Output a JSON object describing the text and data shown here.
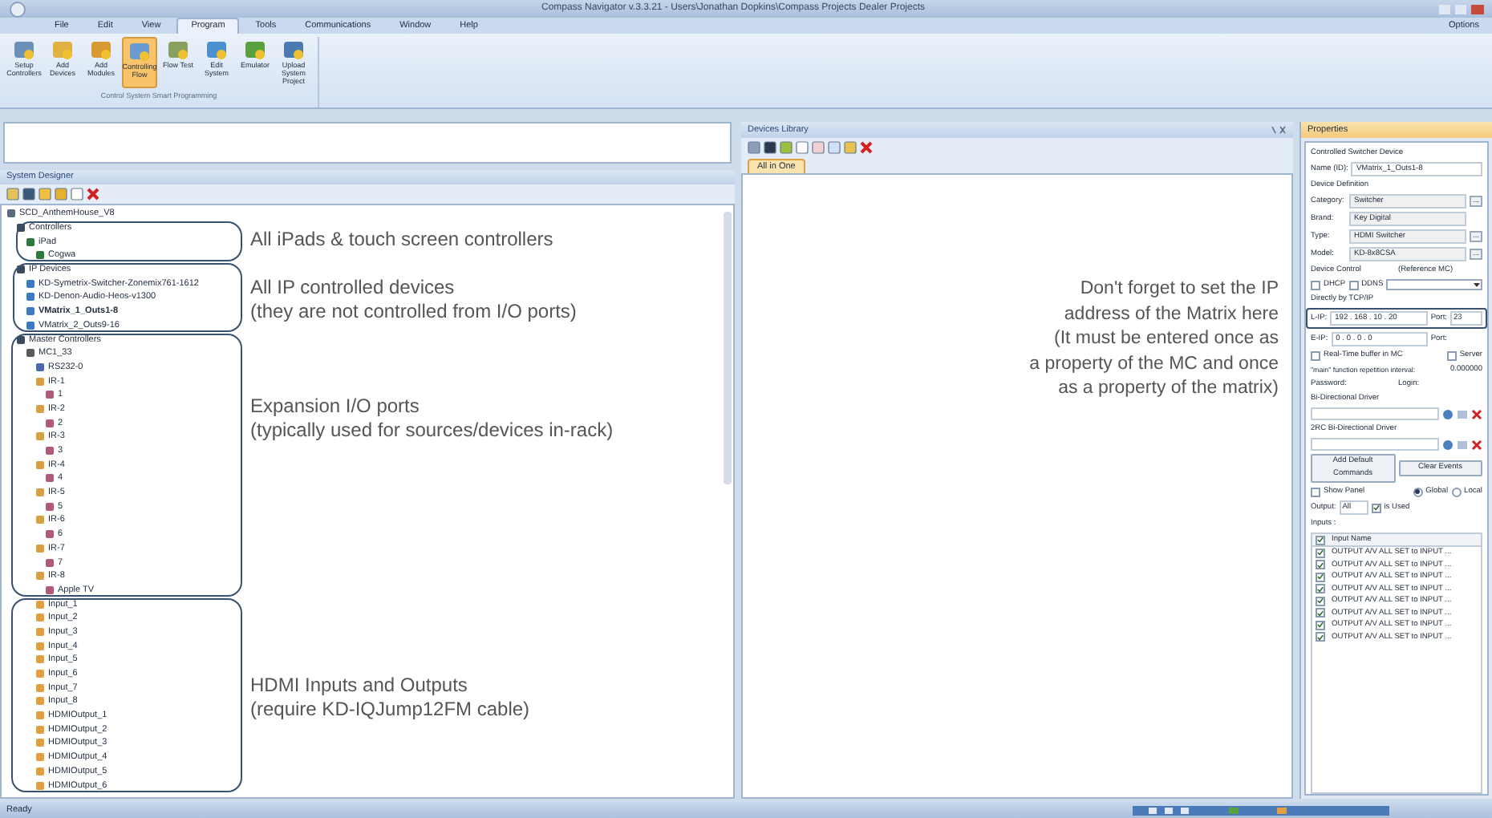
{
  "window": {
    "title": "Compass Navigator v.3.3.21 - Users\\Jonathan Dopkins\\Compass Projects Dealer Projects",
    "options": "Options"
  },
  "menu": [
    {
      "label": "File",
      "selected": false
    },
    {
      "label": "Edit",
      "selected": false
    },
    {
      "label": "View",
      "selected": false
    },
    {
      "label": "Program",
      "selected": true
    },
    {
      "label": "Tools",
      "selected": false
    },
    {
      "label": "Communications",
      "selected": false
    },
    {
      "label": "Window",
      "selected": false
    },
    {
      "label": "Help",
      "selected": false
    }
  ],
  "ribbon": {
    "buttons": [
      {
        "label": "Setup Controllers",
        "selected": false
      },
      {
        "label": "Add Devices",
        "selected": false
      },
      {
        "label": "Add Modules",
        "selected": false
      },
      {
        "label": "Controlling Flow",
        "selected": true
      },
      {
        "label": "Flow Test",
        "selected": false
      },
      {
        "label": "Edit System",
        "selected": false
      },
      {
        "label": "Emulator",
        "selected": false
      },
      {
        "label": "Upload System Project",
        "selected": false
      }
    ],
    "group_label": "Control System Smart Programming"
  },
  "system_designer": {
    "title": "System Designer",
    "tree": [
      {
        "label": "SCD_AnthemHouse_V8",
        "kind": "root",
        "bold": false,
        "children": [
          {
            "label": "Controllers",
            "kind": "folder",
            "bold": false,
            "children": [
              {
                "label": "iPad",
                "kind": "ipad",
                "bold": false,
                "children": [
                  {
                    "label": "Cogwa",
                    "kind": "ipad",
                    "bold": false
                  }
                ]
              }
            ]
          },
          {
            "label": "IP Devices",
            "kind": "folder",
            "bold": false,
            "children": [
              {
                "label": "KD-Symetrix-Switcher-Zonemix761-1612",
                "kind": "device",
                "bold": false
              },
              {
                "label": "KD-Denon-Audio-Heos-v1300",
                "kind": "device",
                "bold": false
              },
              {
                "label": "VMatrix_1_Outs1-8",
                "kind": "device",
                "bold": true
              },
              {
                "label": "VMatrix_2_Outs9-16",
                "kind": "device",
                "bold": false
              }
            ]
          },
          {
            "label": "Master Controllers",
            "kind": "folder",
            "bold": false,
            "children": [
              {
                "label": "MC1_33",
                "kind": "controller",
                "bold": false,
                "children": [
                  {
                    "label": "RS232-0",
                    "kind": "port",
                    "bold": false
                  },
                  {
                    "label": "IR-1",
                    "kind": "ir",
                    "bold": false,
                    "children": [
                      {
                        "label": "1",
                        "kind": "module",
                        "bold": false
                      }
                    ]
                  },
                  {
                    "label": "IR-2",
                    "kind": "ir",
                    "bold": false,
                    "children": [
                      {
                        "label": "2",
                        "kind": "module",
                        "bold": false
                      }
                    ]
                  },
                  {
                    "label": "IR-3",
                    "kind": "ir",
                    "bold": false,
                    "children": [
                      {
                        "label": "3",
                        "kind": "module",
                        "bold": false
                      }
                    ]
                  },
                  {
                    "label": "IR-4",
                    "kind": "ir",
                    "bold": false,
                    "children": [
                      {
                        "label": "4",
                        "kind": "module",
                        "bold": false
                      }
                    ]
                  },
                  {
                    "label": "IR-5",
                    "kind": "ir",
                    "bold": false,
                    "children": [
                      {
                        "label": "5",
                        "kind": "module",
                        "bold": false
                      }
                    ]
                  },
                  {
                    "label": "IR-6",
                    "kind": "ir",
                    "bold": false,
                    "children": [
                      {
                        "label": "6",
                        "kind": "module",
                        "bold": false
                      }
                    ]
                  },
                  {
                    "label": "IR-7",
                    "kind": "ir",
                    "bold": false,
                    "children": [
                      {
                        "label": "7",
                        "kind": "module",
                        "bold": false
                      }
                    ]
                  },
                  {
                    "label": "IR-8",
                    "kind": "ir",
                    "bold": false,
                    "children": [
                      {
                        "label": "Apple TV",
                        "kind": "module",
                        "bold": false
                      }
                    ]
                  },
                  {
                    "label": "Input_1",
                    "kind": "input",
                    "bold": false
                  },
                  {
                    "label": "Input_2",
                    "kind": "input",
                    "bold": false
                  },
                  {
                    "label": "Input_3",
                    "kind": "input",
                    "bold": false
                  },
                  {
                    "label": "Input_4",
                    "kind": "input",
                    "bold": false
                  },
                  {
                    "label": "Input_5",
                    "kind": "input",
                    "bold": false
                  },
                  {
                    "label": "Input_6",
                    "kind": "input",
                    "bold": false
                  },
                  {
                    "label": "Input_7",
                    "kind": "input",
                    "bold": false
                  },
                  {
                    "label": "Input_8",
                    "kind": "input",
                    "bold": false
                  },
                  {
                    "label": "HDMIOutput_1",
                    "kind": "input",
                    "bold": false
                  },
                  {
                    "label": "HDMIOutput_2",
                    "kind": "input",
                    "bold": false
                  },
                  {
                    "label": "HDMIOutput_3",
                    "kind": "input",
                    "bold": false
                  },
                  {
                    "label": "HDMIOutput_4",
                    "kind": "input",
                    "bold": false
                  },
                  {
                    "label": "HDMIOutput_5",
                    "kind": "input",
                    "bold": false
                  },
                  {
                    "label": "HDMIOutput_6",
                    "kind": "input",
                    "bold": false
                  }
                ]
              }
            ]
          }
        ]
      }
    ],
    "annotations": [
      {
        "lines": [
          "All iPads & touch screen controllers"
        ]
      },
      {
        "lines": [
          "All IP controlled devices",
          "(they are not controlled from I/O ports)"
        ]
      },
      {
        "lines": [
          "Expansion I/O ports",
          "(typically used for sources/devices in-rack)"
        ]
      },
      {
        "lines": [
          "HDMI Inputs and Outputs",
          "(require KD-IQJump12FM cable)"
        ]
      }
    ]
  },
  "devices_library": {
    "title": "Devices Library",
    "tabs": [
      {
        "label": "All in One",
        "selected": true
      }
    ],
    "note": [
      "Don't forget to set the IP",
      "address of the Matrix here",
      "(It must be entered once as",
      "a property of the MC and once",
      "as a property of the matrix)"
    ]
  },
  "properties": {
    "title": "Properties",
    "heading": "Controlled Switcher Device",
    "name_label": "Name (ID):",
    "name_value": "VMatrix_1_Outs1-8",
    "definition_label": "Device Definition",
    "fields": [
      {
        "label": "Category:",
        "value": "Switcher",
        "button": "..."
      },
      {
        "label": "Brand:",
        "value": "Key Digital"
      },
      {
        "label": "Type:",
        "value": "HDMI Switcher",
        "button": "..."
      },
      {
        "label": "Model:",
        "value": "KD-8x8CSA",
        "button": "..."
      }
    ],
    "control_label": "Device Control",
    "reference_label": "(Reference MC)",
    "dhcp": {
      "label": "DHCP",
      "checked": false
    },
    "ddns": {
      "label": "DDNS",
      "checked": false
    },
    "tcp_label": "Directly by TCP/IP",
    "lip_label": "L-IP:",
    "lip": "192 . 168 . 10 . 20",
    "lport_label": "Port:",
    "lport": "23",
    "eip_label": "E-IP:",
    "eip": "0 . 0 . 0 . 0",
    "eport_label": "Port:",
    "realtime": {
      "label": "Real-Time buffer in MC",
      "checked": false
    },
    "server": {
      "label": "Server",
      "checked": false
    },
    "interval_label": "\"main\" function repetition interval:",
    "interval": "0.000000",
    "password_label": "Password:",
    "login_label": "Login:",
    "bidir_label": "Bi-Directional Driver",
    "bidir2_label": "2RC Bi-Directional Driver",
    "add_button": "Add Default Commands",
    "clear_button": "Clear Events",
    "show_panel": {
      "label": "Show Panel",
      "checked": false
    },
    "scope": [
      {
        "label": "Global",
        "selected": true
      },
      {
        "label": "Local",
        "selected": false
      }
    ],
    "output_label": "Output:",
    "output_value": "All",
    "is_used": {
      "label": "is Used",
      "checked": true
    },
    "inputs_label": "Inputs :",
    "inputs_header": "Input Name",
    "header_checked": true,
    "inputs": [
      {
        "name": "OUTPUT A/V ALL SET to INPUT ...",
        "checked": true
      },
      {
        "name": "OUTPUT A/V ALL SET to INPUT ...",
        "checked": true
      },
      {
        "name": "OUTPUT A/V ALL SET to INPUT ...",
        "checked": true
      },
      {
        "name": "OUTPUT A/V ALL SET to INPUT ...",
        "checked": true
      },
      {
        "name": "OUTPUT A/V ALL SET to INPUT ...",
        "checked": true
      },
      {
        "name": "OUTPUT A/V ALL SET to INPUT ...",
        "checked": true
      },
      {
        "name": "OUTPUT A/V ALL SET to INPUT ...",
        "checked": true
      },
      {
        "name": "OUTPUT A/V ALL SET to INPUT ...",
        "checked": true
      }
    ]
  },
  "status_bar": {
    "text": "Ready"
  }
}
